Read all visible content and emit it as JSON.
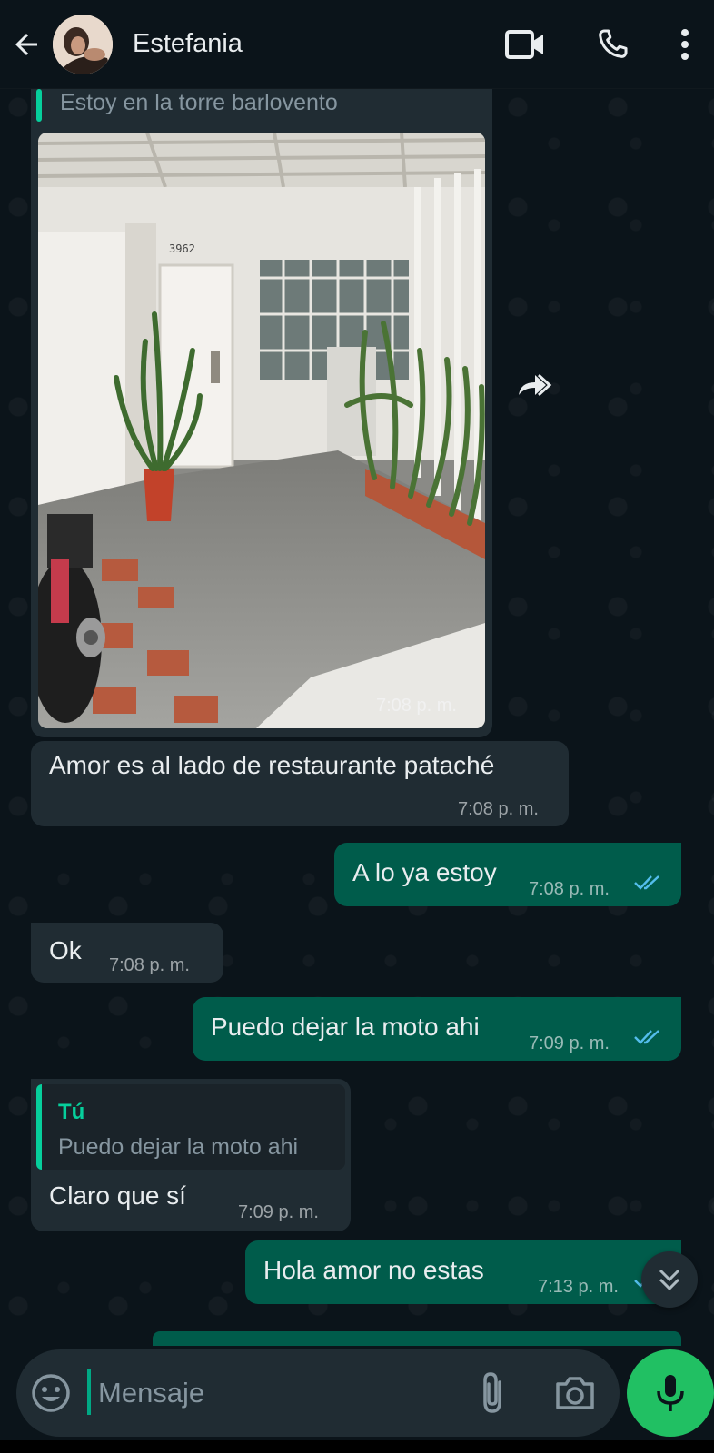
{
  "header": {
    "back_icon": "arrow-left-icon",
    "contact_name": "Estefania",
    "video_icon": "video-camera-icon",
    "call_icon": "phone-icon",
    "menu_icon": "more-vertical-icon"
  },
  "messages": [
    {
      "id": "m1",
      "direction": "incoming",
      "quoted_text": "Estoy en la torre barlovento",
      "has_image": true,
      "time": "7:08 p. m."
    },
    {
      "id": "m2",
      "direction": "incoming",
      "text": "Amor es al lado de restaurante pataché",
      "time": "7:08 p. m."
    },
    {
      "id": "m3",
      "direction": "outgoing",
      "text": "A lo ya estoy",
      "time": "7:08 p. m.",
      "status": "read"
    },
    {
      "id": "m4",
      "direction": "incoming",
      "text": "Ok",
      "time": "7:08 p. m."
    },
    {
      "id": "m5",
      "direction": "outgoing",
      "text": "Puedo dejar la moto ahi",
      "time": "7:09 p. m.",
      "status": "read"
    },
    {
      "id": "m6",
      "direction": "incoming",
      "reply_author": "Tú",
      "reply_text": "Puedo dejar la moto ahi",
      "text": "Claro que sí",
      "time": "7:09 p. m."
    },
    {
      "id": "m7",
      "direction": "outgoing",
      "text": "Hola amor no estas",
      "time": "7:13 p. m.",
      "status": "read"
    }
  ],
  "photo": {
    "house_number": "3962"
  },
  "composer": {
    "placeholder": "Mensaje",
    "emoji_icon": "emoji-icon",
    "attach_icon": "paperclip-icon",
    "camera_icon": "camera-icon",
    "mic_icon": "microphone-icon"
  },
  "colors": {
    "background": "#0b141a",
    "incoming_bubble": "#202c33",
    "outgoing_bubble": "#005c4b",
    "accent": "#00a884",
    "mic_button": "#21c063",
    "read_ticks": "#53bdeb"
  }
}
